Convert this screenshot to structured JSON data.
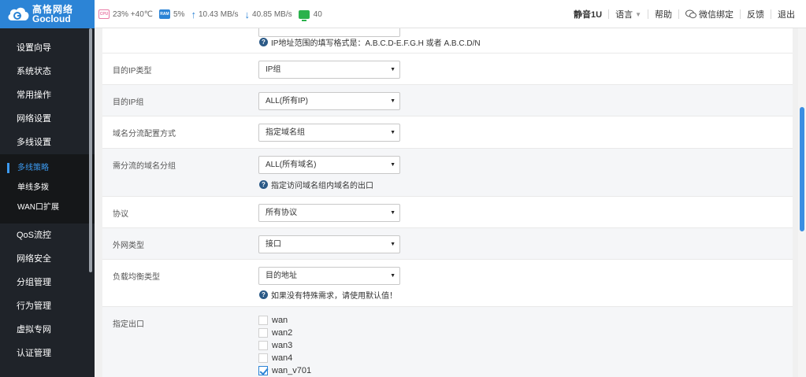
{
  "brand": {
    "name_cn": "高恪网络",
    "name_en": "Gocloud"
  },
  "stats": {
    "cpu_label": "CPU",
    "cpu_value": "23% +40℃",
    "ram_label": "RAM",
    "ram_value": "5%",
    "upload": "10.43 MB/s",
    "download": "40.85 MB/s",
    "connections": "40"
  },
  "topnav": {
    "mute": "静音1U",
    "language": "语言",
    "help": "帮助",
    "wechat": "微信绑定",
    "feedback": "反馈",
    "logout": "退出"
  },
  "sidebar": {
    "items_top": [
      "设置向导",
      "系统状态",
      "常用操作",
      "网络设置",
      "多线设置"
    ],
    "sub_items": [
      "多线策略",
      "单线多拨",
      "WAN口扩展"
    ],
    "items_bottom": [
      "QoS流控",
      "网络安全",
      "分组管理",
      "行为管理",
      "虚拟专网",
      "认证管理"
    ]
  },
  "form": {
    "ip_range_hint": "IP地址范围的填写格式是：A.B.C.D-E.F.G.H 或者 A.B.C.D/N",
    "dest_ip_type": {
      "label": "目的IP类型",
      "value": "IP组"
    },
    "dest_ip_group": {
      "label": "目的IP组",
      "value": "ALL(所有IP)"
    },
    "domain_mode": {
      "label": "域名分流配置方式",
      "value": "指定域名组"
    },
    "domain_group": {
      "label": "需分流的域名分组",
      "value": "ALL(所有域名)",
      "hint": "指定访问域名组内域名的出口"
    },
    "protocol": {
      "label": "协议",
      "value": "所有协议"
    },
    "wan_type": {
      "label": "外网类型",
      "value": "接口"
    },
    "lb_type": {
      "label": "负载均衡类型",
      "value": "目的地址",
      "hint": "如果没有特殊需求，请使用默认值！"
    },
    "exit": {
      "label": "指定出口",
      "options": [
        {
          "name": "wan",
          "checked": false
        },
        {
          "name": "wan2",
          "checked": false
        },
        {
          "name": "wan3",
          "checked": false
        },
        {
          "name": "wan4",
          "checked": false
        },
        {
          "name": "wan_v701",
          "checked": true
        }
      ]
    }
  }
}
